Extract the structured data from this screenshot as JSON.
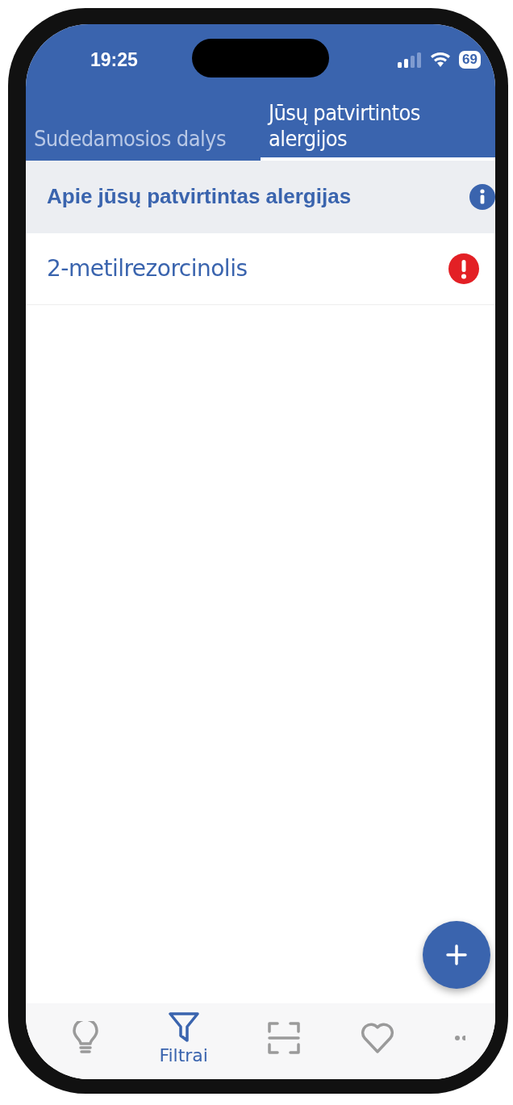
{
  "status_bar": {
    "time": "19:25",
    "battery": "69"
  },
  "tabs": [
    {
      "label": "Sudedamosios dalys",
      "selected": false
    },
    {
      "label": "Jūsų patvirtintos alergijos",
      "selected": true
    }
  ],
  "info_header": {
    "title": "Apie jūsų patvirtintas alergijas"
  },
  "allergies": [
    {
      "name": "2-metilrezorcinolis",
      "warning": true
    }
  ],
  "bottom_nav": [
    {
      "kind": "bulb",
      "selected": false
    },
    {
      "kind": "filter",
      "label": "Filtrai",
      "selected": true
    },
    {
      "kind": "scan",
      "selected": false
    },
    {
      "kind": "heart",
      "selected": false
    },
    {
      "kind": "more",
      "selected": false
    }
  ]
}
